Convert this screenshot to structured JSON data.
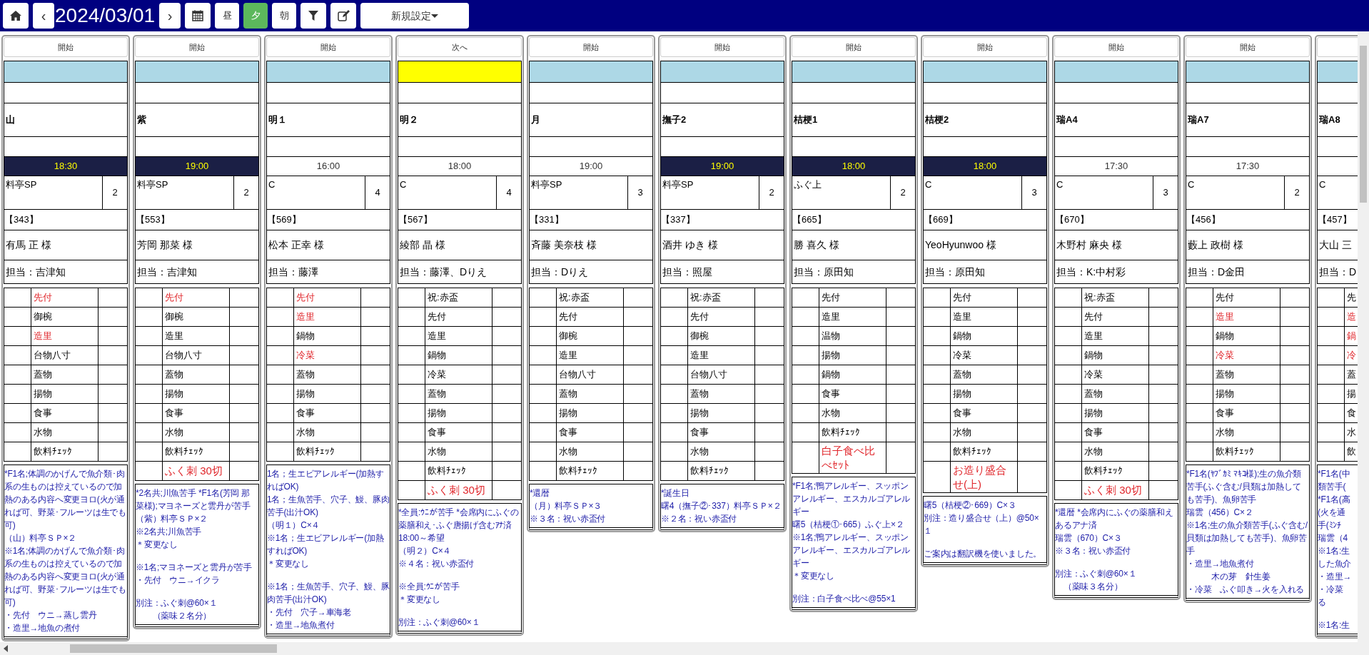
{
  "toolbar": {
    "prev": "‹",
    "date": "2024/03/01",
    "next": "›",
    "shifts": [
      {
        "label": "昼",
        "selected": false
      },
      {
        "label": "夕",
        "selected": true
      },
      {
        "label": "朝",
        "selected": false
      }
    ],
    "preset": "新規設定"
  },
  "columns": [
    {
      "action": "開始",
      "color": "#add8e6",
      "room": "山",
      "time": "18:30",
      "time_highlight": true,
      "course": "料亭SP",
      "count": "2",
      "booking": "【343】",
      "guest": "有馬 正 様",
      "staff": "担当：吉津知",
      "menu": [
        {
          "kind": "dish",
          "text": "先付",
          "alert": true
        },
        {
          "kind": "dish",
          "text": "御椀",
          "alert": false
        },
        {
          "kind": "dish",
          "text": "造里",
          "alert": true
        },
        {
          "kind": "dish",
          "text": "台物八寸",
          "alert": false
        },
        {
          "kind": "dish",
          "text": "蓋物",
          "alert": false
        },
        {
          "kind": "dish",
          "text": "揚物",
          "alert": false
        },
        {
          "kind": "dish",
          "text": "食事",
          "alert": false
        },
        {
          "kind": "dish",
          "text": "水物",
          "alert": false
        },
        {
          "kind": "dish",
          "text": "飲料ﾁｪｯｸ",
          "alert": false
        }
      ],
      "notes": [
        [
          "*F1名;体調のかげんで魚介類･肉系の生ものは控えているので加熱のある内容へ変更ヨロ(火が通れば可、野菜･フルーツは生でも可)",
          "（山）料亭ＳＰ×２",
          "※1名;体調のかげんで魚介類･肉系の生ものは控えているので加熱のある内容へ変更ヨロ(火が通れば可、野菜･フルーツは生でも可)",
          "・先付　ウニ→蒸し雲丹",
          "・造里→地魚の煮付"
        ]
      ]
    },
    {
      "action": "開始",
      "color": "#add8e6",
      "room": "紫",
      "time": "19:00",
      "time_highlight": true,
      "course": "料亭SP",
      "count": "2",
      "booking": "【553】",
      "guest": "芳岡 那菜 様",
      "staff": "担当：吉津知",
      "menu": [
        {
          "kind": "dish",
          "text": "先付",
          "alert": true
        },
        {
          "kind": "dish",
          "text": "御椀",
          "alert": false
        },
        {
          "kind": "dish",
          "text": "造里",
          "alert": false
        },
        {
          "kind": "dish",
          "text": "台物八寸",
          "alert": false
        },
        {
          "kind": "dish",
          "text": "蓋物",
          "alert": false
        },
        {
          "kind": "dish",
          "text": "揚物",
          "alert": false
        },
        {
          "kind": "dish",
          "text": "食事",
          "alert": false
        },
        {
          "kind": "dish",
          "text": "水物",
          "alert": false
        },
        {
          "kind": "dish",
          "text": "飲料ﾁｪｯｸ",
          "alert": false
        },
        {
          "kind": "extra",
          "text": "ふく刺 30切",
          "alert": true
        }
      ],
      "notes": [
        [
          "*2名共;川魚苦手 *F1名(芳岡 那菜様);マヨネーズと雲丹が苦手",
          "（紫）料亭ＳＰ×２",
          "※2名共;川魚苦手",
          "＊変更なし"
        ],
        [
          "※1名;マヨネーズと雲丹が苦手",
          "・先付　ウニ→イクラ"
        ],
        [
          "別注：ふぐ刺@60×１",
          "　　（薬味２名分）"
        ]
      ]
    },
    {
      "action": "開始",
      "color": "#add8e6",
      "room": "明１",
      "time": "16:00",
      "time_highlight": false,
      "course": "C",
      "count": "4",
      "booking": "【569】",
      "guest": "松本 正幸 様",
      "staff": "担当：藤澤",
      "menu": [
        {
          "kind": "dish",
          "text": "先付",
          "alert": true
        },
        {
          "kind": "dish",
          "text": "造里",
          "alert": true
        },
        {
          "kind": "dish",
          "text": "鍋物",
          "alert": false
        },
        {
          "kind": "dish",
          "text": "冷菜",
          "alert": true
        },
        {
          "kind": "dish",
          "text": "蓋物",
          "alert": false
        },
        {
          "kind": "dish",
          "text": "揚物",
          "alert": false
        },
        {
          "kind": "dish",
          "text": "食事",
          "alert": false
        },
        {
          "kind": "dish",
          "text": "水物",
          "alert": false
        },
        {
          "kind": "dish",
          "text": "飲料ﾁｪｯｸ",
          "alert": false
        }
      ],
      "notes": [
        [
          "1名；生エビアレルギー(加熱すればOK)",
          "1名；生魚苦手、穴子、鰻、豚肉苦手(出汁OK)",
          "（明１）C×４",
          "※1名；生エビアレルギー(加熱すればOK)",
          "＊変更なし"
        ],
        [
          "※1名；生魚苦手、穴子、鰻、豚肉苦手(出汁OK)",
          "・先付　穴子→車海老",
          "・造里→地魚煮付"
        ]
      ]
    },
    {
      "action": "次へ",
      "color": "#ffff00",
      "room": "明２",
      "time": "18:00",
      "time_highlight": false,
      "course": "C",
      "count": "4",
      "booking": "【567】",
      "guest": "綾部 晶 様",
      "staff": "担当：藤澤、Dりえ",
      "menu": [
        {
          "kind": "dish",
          "text": "祝:赤盃",
          "alert": false
        },
        {
          "kind": "dish",
          "text": "先付",
          "alert": false
        },
        {
          "kind": "dish",
          "text": "造里",
          "alert": false
        },
        {
          "kind": "dish",
          "text": "鍋物",
          "alert": false
        },
        {
          "kind": "dish",
          "text": "冷菜",
          "alert": false
        },
        {
          "kind": "dish",
          "text": "蓋物",
          "alert": false
        },
        {
          "kind": "dish",
          "text": "揚物",
          "alert": false
        },
        {
          "kind": "dish",
          "text": "食事",
          "alert": false
        },
        {
          "kind": "dish",
          "text": "水物",
          "alert": false
        },
        {
          "kind": "dish",
          "text": "飲料ﾁｪｯｸ",
          "alert": false
        },
        {
          "kind": "extra",
          "text": "ふく刺 30切",
          "alert": true
        }
      ],
      "notes": [
        [
          "*全員:ｳﾆが苦手 *会席内にふぐの薬膳和え･ふぐ唐揚げ含むｱﾅ済",
          "18:00～希望",
          "（明２）C×４",
          "※４名：祝い赤盃付"
        ],
        [
          "※全員:ｳﾆが苦手",
          "＊変更なし"
        ],
        [
          "別注：ふぐ刺@60×１"
        ]
      ]
    },
    {
      "action": "開始",
      "color": "#add8e6",
      "room": "月",
      "time": "19:00",
      "time_highlight": false,
      "course": "料亭SP",
      "count": "3",
      "booking": "【331】",
      "guest": "斉藤 美奈枝 様",
      "staff": "担当：Dりえ",
      "menu": [
        {
          "kind": "dish",
          "text": "祝:赤盃",
          "alert": false
        },
        {
          "kind": "dish",
          "text": "先付",
          "alert": false
        },
        {
          "kind": "dish",
          "text": "御椀",
          "alert": false
        },
        {
          "kind": "dish",
          "text": "造里",
          "alert": false
        },
        {
          "kind": "dish",
          "text": "台物八寸",
          "alert": false
        },
        {
          "kind": "dish",
          "text": "蓋物",
          "alert": false
        },
        {
          "kind": "dish",
          "text": "揚物",
          "alert": false
        },
        {
          "kind": "dish",
          "text": "食事",
          "alert": false
        },
        {
          "kind": "dish",
          "text": "水物",
          "alert": false
        },
        {
          "kind": "dish",
          "text": "飲料ﾁｪｯｸ",
          "alert": false
        }
      ],
      "notes": [
        [
          "*還暦",
          "（月）料亭ＳＰ×３",
          "※３名：祝い赤盃付"
        ]
      ]
    },
    {
      "action": "開始",
      "color": "#add8e6",
      "room": "撫子2",
      "time": "19:00",
      "time_highlight": true,
      "course": "料亭SP",
      "count": "2",
      "booking": "【337】",
      "guest": "酒井 ゆき 様",
      "staff": "担当：照屋",
      "menu": [
        {
          "kind": "dish",
          "text": "祝:赤盃",
          "alert": false
        },
        {
          "kind": "dish",
          "text": "先付",
          "alert": false
        },
        {
          "kind": "dish",
          "text": "御椀",
          "alert": false
        },
        {
          "kind": "dish",
          "text": "造里",
          "alert": false
        },
        {
          "kind": "dish",
          "text": "台物八寸",
          "alert": false
        },
        {
          "kind": "dish",
          "text": "蓋物",
          "alert": false
        },
        {
          "kind": "dish",
          "text": "揚物",
          "alert": false
        },
        {
          "kind": "dish",
          "text": "食事",
          "alert": false
        },
        {
          "kind": "dish",
          "text": "水物",
          "alert": false
        },
        {
          "kind": "dish",
          "text": "飲料ﾁｪｯｸ",
          "alert": false
        }
      ],
      "notes": [
        [
          "*誕生日",
          "曙4（撫子②･337）料亭ＳＰ×２",
          "※２名：祝い赤盃付"
        ]
      ]
    },
    {
      "action": "開始",
      "color": "#add8e6",
      "room": "桔梗1",
      "time": "18:00",
      "time_highlight": true,
      "course": "ふぐ上",
      "count": "2",
      "booking": "【665】",
      "guest": "勝 喜久 様",
      "staff": "担当：原田知",
      "menu": [
        {
          "kind": "dish",
          "text": "先付",
          "alert": false
        },
        {
          "kind": "dish",
          "text": "造里",
          "alert": false
        },
        {
          "kind": "dish",
          "text": "温物",
          "alert": false
        },
        {
          "kind": "dish",
          "text": "揚物",
          "alert": false
        },
        {
          "kind": "dish",
          "text": "鍋物",
          "alert": false
        },
        {
          "kind": "dish",
          "text": "食事",
          "alert": false
        },
        {
          "kind": "dish",
          "text": "水物",
          "alert": false
        },
        {
          "kind": "dish",
          "text": "飲料ﾁｪｯｸ",
          "alert": false
        },
        {
          "kind": "extra",
          "text": "白子食べ比べｾｯﾄ",
          "alert": true
        }
      ],
      "notes": [
        [
          "*F1名;鴨アレルギー、スッポンアレルギー、エスカルゴアレルギー",
          "曙5（桔梗①･665）ふぐ上×２",
          "※1名;鴨アレルギー、スッポンアレルギー、エスカルゴアレルギー",
          "＊変更なし"
        ],
        [
          "別注：白子食べ比べ@55×1"
        ]
      ]
    },
    {
      "action": "開始",
      "color": "#add8e6",
      "room": "桔梗2",
      "time": "18:00",
      "time_highlight": true,
      "course": "C",
      "count": "3",
      "booking": "【669】",
      "guest": "YeoHyunwoo 様",
      "staff": "担当：原田知",
      "menu": [
        {
          "kind": "dish",
          "text": "先付",
          "alert": false
        },
        {
          "kind": "dish",
          "text": "造里",
          "alert": false
        },
        {
          "kind": "dish",
          "text": "鍋物",
          "alert": false
        },
        {
          "kind": "dish",
          "text": "冷菜",
          "alert": false
        },
        {
          "kind": "dish",
          "text": "蓋物",
          "alert": false
        },
        {
          "kind": "dish",
          "text": "揚物",
          "alert": false
        },
        {
          "kind": "dish",
          "text": "食事",
          "alert": false
        },
        {
          "kind": "dish",
          "text": "水物",
          "alert": false
        },
        {
          "kind": "dish",
          "text": "飲料ﾁｪｯｸ",
          "alert": false
        },
        {
          "kind": "extra",
          "text": "お造り盛合せ(上)",
          "alert": true
        }
      ],
      "notes": [
        [
          "曙5（桔梗②･669）C×３",
          "別注：造り盛合せ（上）@50×１"
        ],
        [
          "ご案内は翻訳機を使いました。"
        ]
      ]
    },
    {
      "action": "開始",
      "color": "#add8e6",
      "room": "瑞A4",
      "time": "17:30",
      "time_highlight": false,
      "course": "C",
      "count": "3",
      "booking": "【670】",
      "guest": "木野村 麻央 様",
      "staff": "担当：K:中村彩",
      "menu": [
        {
          "kind": "dish",
          "text": "祝:赤盃",
          "alert": false
        },
        {
          "kind": "dish",
          "text": "先付",
          "alert": false
        },
        {
          "kind": "dish",
          "text": "造里",
          "alert": false
        },
        {
          "kind": "dish",
          "text": "鍋物",
          "alert": false
        },
        {
          "kind": "dish",
          "text": "冷菜",
          "alert": false
        },
        {
          "kind": "dish",
          "text": "蓋物",
          "alert": false
        },
        {
          "kind": "dish",
          "text": "揚物",
          "alert": false
        },
        {
          "kind": "dish",
          "text": "食事",
          "alert": false
        },
        {
          "kind": "dish",
          "text": "水物",
          "alert": false
        },
        {
          "kind": "dish",
          "text": "飲料ﾁｪｯｸ",
          "alert": false
        },
        {
          "kind": "extra",
          "text": "ふく刺 30切",
          "alert": true
        }
      ],
      "notes": [
        [
          "*還暦 *会席内にふぐの薬膳和えあるアナ済",
          "瑞雲（670）C×３",
          "※３名：祝い赤盃付"
        ],
        [
          "別注：ふぐ刺@60×１",
          "　（薬味３名分）"
        ]
      ]
    },
    {
      "action": "開始",
      "color": "#add8e6",
      "room": "瑞A7",
      "time": "17:30",
      "time_highlight": false,
      "course": "C",
      "count": "2",
      "booking": "【456】",
      "guest": "藪上 政樹 様",
      "staff": "担当：D金田",
      "menu": [
        {
          "kind": "dish",
          "text": "先付",
          "alert": false
        },
        {
          "kind": "dish",
          "text": "造里",
          "alert": true
        },
        {
          "kind": "dish",
          "text": "鍋物",
          "alert": false
        },
        {
          "kind": "dish",
          "text": "冷菜",
          "alert": true
        },
        {
          "kind": "dish",
          "text": "蓋物",
          "alert": false
        },
        {
          "kind": "dish",
          "text": "揚物",
          "alert": false
        },
        {
          "kind": "dish",
          "text": "食事",
          "alert": false
        },
        {
          "kind": "dish",
          "text": "水物",
          "alert": false
        },
        {
          "kind": "dish",
          "text": "飲料ﾁｪｯｸ",
          "alert": false
        }
      ],
      "notes": [
        [
          "*F1名(ﾔﾌﾞｶﾐ ﾏｷｺ様);生の魚介類苦手(ふぐ含む/貝類は加熱しても苦手)、魚卵苦手",
          "瑞雲（456）C×２",
          "※1名;生の魚介類苦手(ふぐ含む/貝類は加熱しても苦手)、魚卵苦手",
          "・造里→地魚煮付",
          "　　　木の芽　針生姜",
          "・冷菜　ふぐ叩き→火を入れる"
        ]
      ]
    },
    {
      "color": "#add8e6",
      "room": "瑞A8",
      "time_highlight": false,
      "course": "C",
      "booking": "【457】",
      "guest": "大山 三",
      "staff": "担当：D",
      "menu": [
        {
          "kind": "dish",
          "text": "先",
          "alert": false
        },
        {
          "kind": "dish",
          "text": "造",
          "alert": true
        },
        {
          "kind": "dish",
          "text": "鍋",
          "alert": true
        },
        {
          "kind": "dish",
          "text": "冷",
          "alert": true
        },
        {
          "kind": "dish",
          "text": "蓋",
          "alert": false
        },
        {
          "kind": "dish",
          "text": "揚",
          "alert": false
        },
        {
          "kind": "dish",
          "text": "食",
          "alert": false
        },
        {
          "kind": "dish",
          "text": "水",
          "alert": false
        },
        {
          "kind": "dish",
          "text": "飲",
          "alert": false
        }
      ],
      "notes": [
        [
          "*F1名(中",
          "類苦手(",
          "*F1名(高",
          "(火を通",
          "手(ﾐﾝﾁ",
          "瑞雲（4",
          "※1名:生",
          "した魚介",
          "・造里→",
          "・冷菜",
          "る"
        ],
        [
          "※1名:生"
        ]
      ]
    }
  ]
}
